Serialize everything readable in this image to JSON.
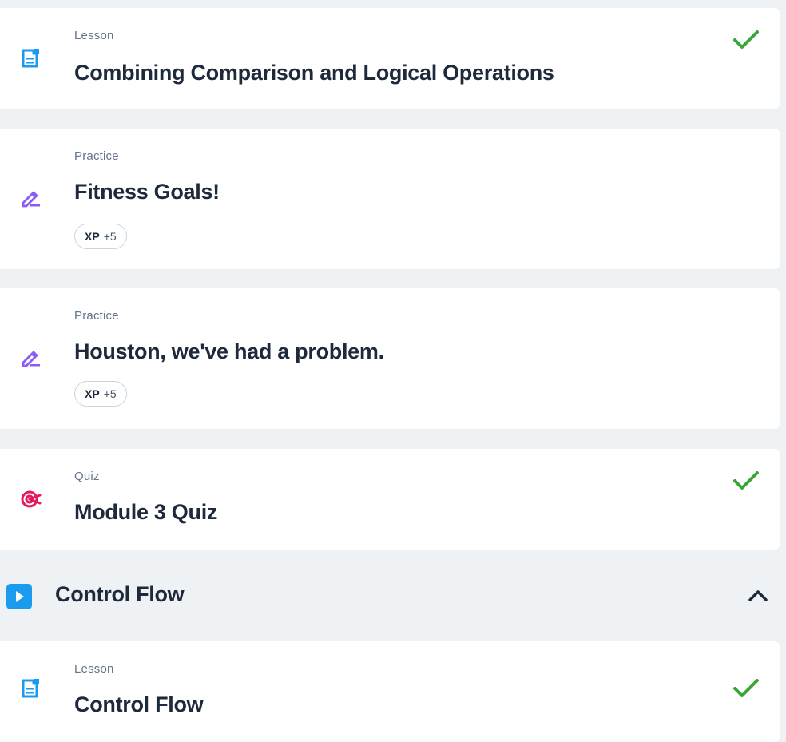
{
  "items": [
    {
      "type": "Lesson",
      "title": "Combining Comparison and Logical Operations",
      "icon": "lesson-doc-icon",
      "completed": true
    },
    {
      "type": "Practice",
      "title": "Fitness Goals!",
      "icon": "practice-pencil-icon",
      "xp_label": "XP",
      "xp_value": "+5",
      "completed": false
    },
    {
      "type": "Practice",
      "title": "Houston, we've had a problem.",
      "icon": "practice-pencil-icon",
      "xp_label": "XP",
      "xp_value": "+5",
      "completed": false
    },
    {
      "type": "Quiz",
      "title": "Module 3 Quiz",
      "icon": "quiz-target-icon",
      "completed": true
    },
    {
      "type": "Lesson",
      "title": "Control Flow",
      "icon": "lesson-doc-icon",
      "completed": true
    }
  ],
  "section": {
    "title": "Control Flow",
    "icon": "play-icon",
    "expanded": true
  },
  "colors": {
    "lesson": "#1a9bf0",
    "practice": "#8b5cf6",
    "quiz": "#e5195f",
    "check": "#3aa63a",
    "background": "#eff2f5"
  }
}
